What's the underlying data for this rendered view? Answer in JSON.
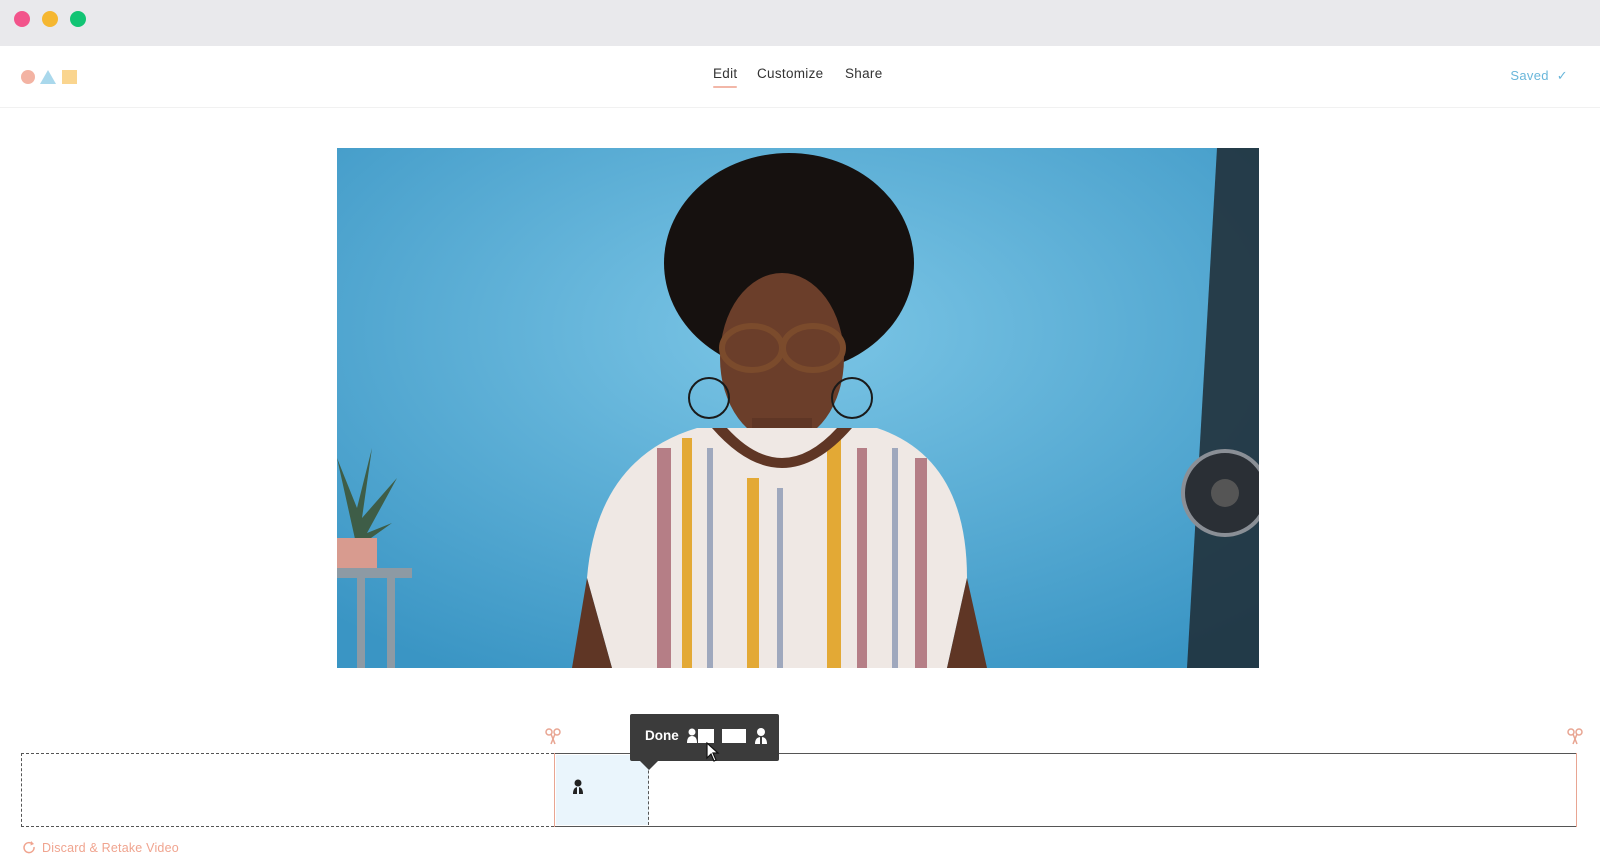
{
  "window": {
    "controls": [
      "close",
      "minimize",
      "maximize"
    ]
  },
  "header": {
    "logo_icons": [
      "circle-shape-icon",
      "triangle-shape-icon",
      "square-shape-icon"
    ],
    "tabs": [
      {
        "label": "Edit",
        "active": true
      },
      {
        "label": "Customize",
        "active": false
      },
      {
        "label": "Share",
        "active": false
      }
    ],
    "status": {
      "label": "Saved",
      "icon": "checkmark-icon"
    }
  },
  "video": {
    "description_icon": "video-frame"
  },
  "timeline": {
    "popover": {
      "done_label": "Done",
      "layout_icons": [
        "person-with-screen-layout-icon",
        "screen-only-layout-icon",
        "person-only-layout-icon"
      ]
    },
    "segment_icon": "person-icon",
    "cut_icons": [
      "scissors-icon",
      "scissors-icon"
    ],
    "discard_label": "Discard & Retake Video"
  },
  "colors": {
    "accent": "#f2b7a8",
    "saved": "#69b6da",
    "discard": "#f0a48f",
    "popover_bg": "#3b3b3b",
    "segment_bg": "#eaf5fc"
  }
}
